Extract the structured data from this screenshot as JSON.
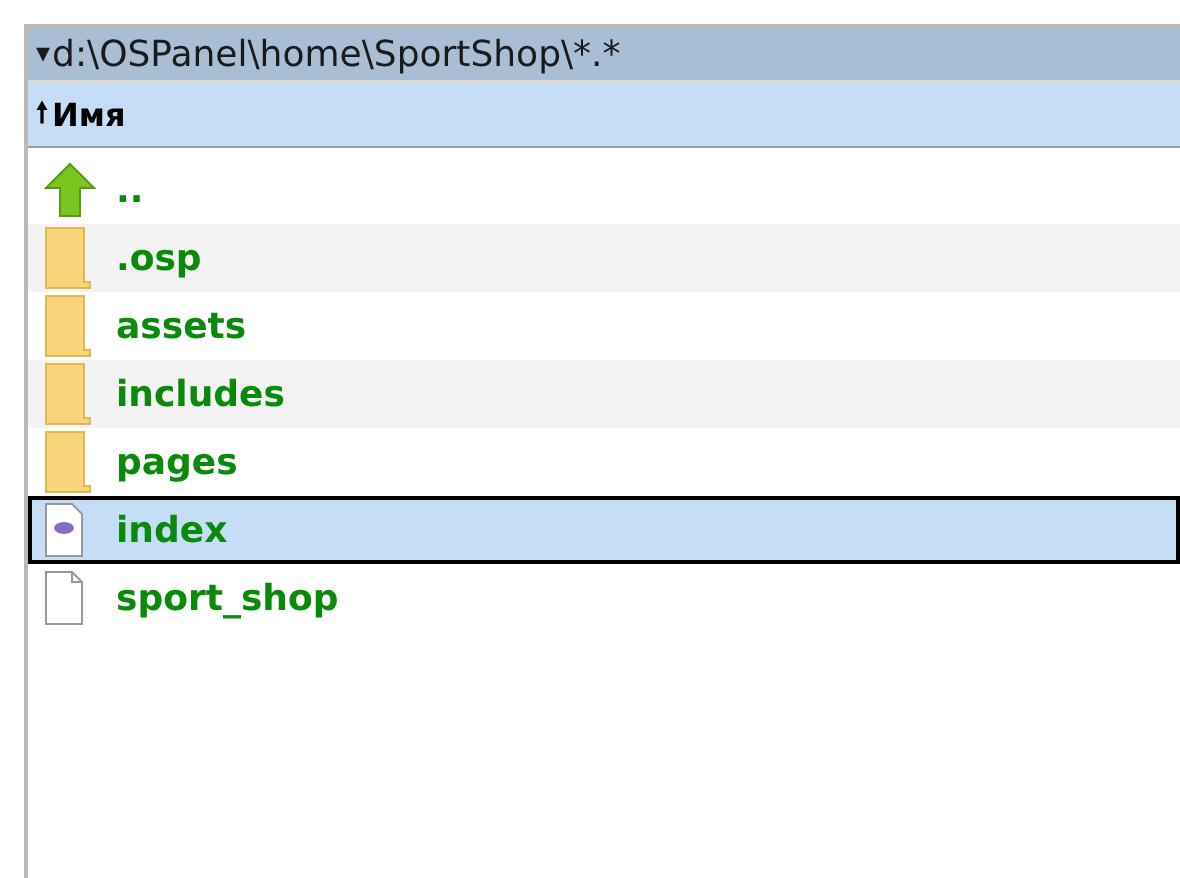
{
  "path_bar": {
    "caret": "▾",
    "path": "d:\\OSPanel\\home\\SportShop\\*.*"
  },
  "header": {
    "sort_arrow": "🠕",
    "label": "Имя"
  },
  "rows": [
    {
      "kind": "up",
      "name": "..",
      "selected": false
    },
    {
      "kind": "folder",
      "name": ".osp",
      "selected": false
    },
    {
      "kind": "folder",
      "name": "assets",
      "selected": false
    },
    {
      "kind": "folder",
      "name": "includes",
      "selected": false
    },
    {
      "kind": "folder",
      "name": "pages",
      "selected": false
    },
    {
      "kind": "php",
      "name": "index",
      "selected": true
    },
    {
      "kind": "file",
      "name": "sport_shop",
      "selected": false
    }
  ]
}
